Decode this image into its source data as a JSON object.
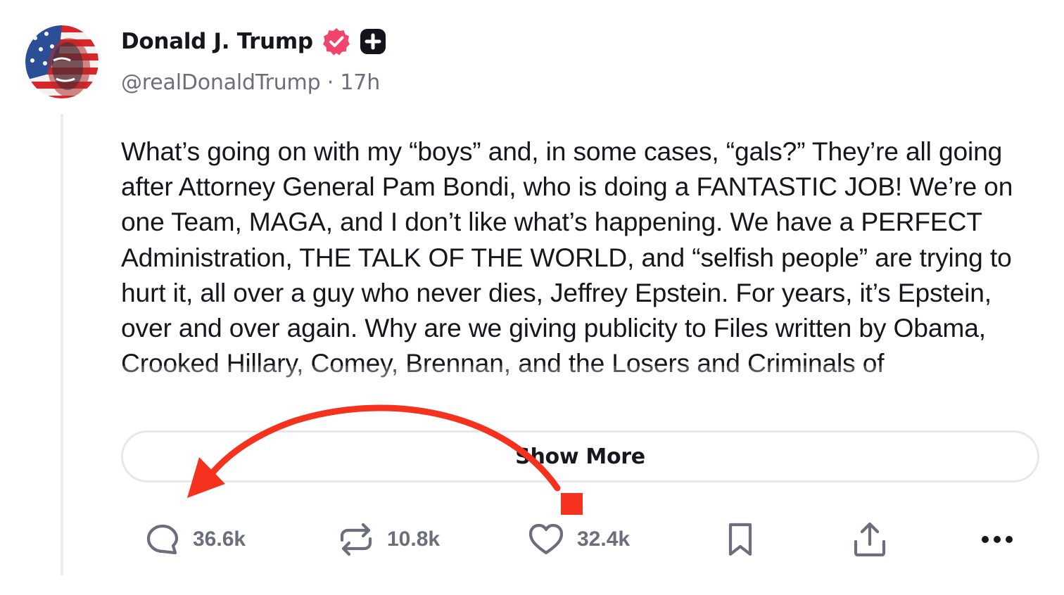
{
  "author": {
    "display_name": "Donald J. Trump",
    "handle_line": "@realDonaldTrump · 17h",
    "verified_icon": "verified-badge-icon",
    "badge_icon": "plus-badge-icon",
    "verified_color": "#f0466e"
  },
  "post": {
    "text": "What’s going on with my “boys” and, in some cases, “gals?” They’re all going after Attorney General Pam Bondi, who is doing a FANTASTIC JOB! We’re on one Team, MAGA, and I don’t like what’s happening. We have a PERFECT Administration, THE TALK OF THE WORLD, and “selfish people” are trying to hurt it, all over a guy who never dies, Jeffrey Epstein. For years, it’s Epstein, over and over again. Why are we giving publicity to Files written by Obama, Crooked Hillary, Comey, Brennan, and the Losers and Criminals of",
    "show_more_label": "Show More"
  },
  "actions": {
    "reply_count": "36.6k",
    "repost_count": "10.8k",
    "like_count": "32.4k",
    "icons": [
      "reply-icon",
      "repost-icon",
      "like-icon",
      "bookmark-icon",
      "share-icon",
      "more-icon"
    ],
    "icon_color": "#6b6f7b"
  },
  "annotation": {
    "color": "#f5321e"
  }
}
